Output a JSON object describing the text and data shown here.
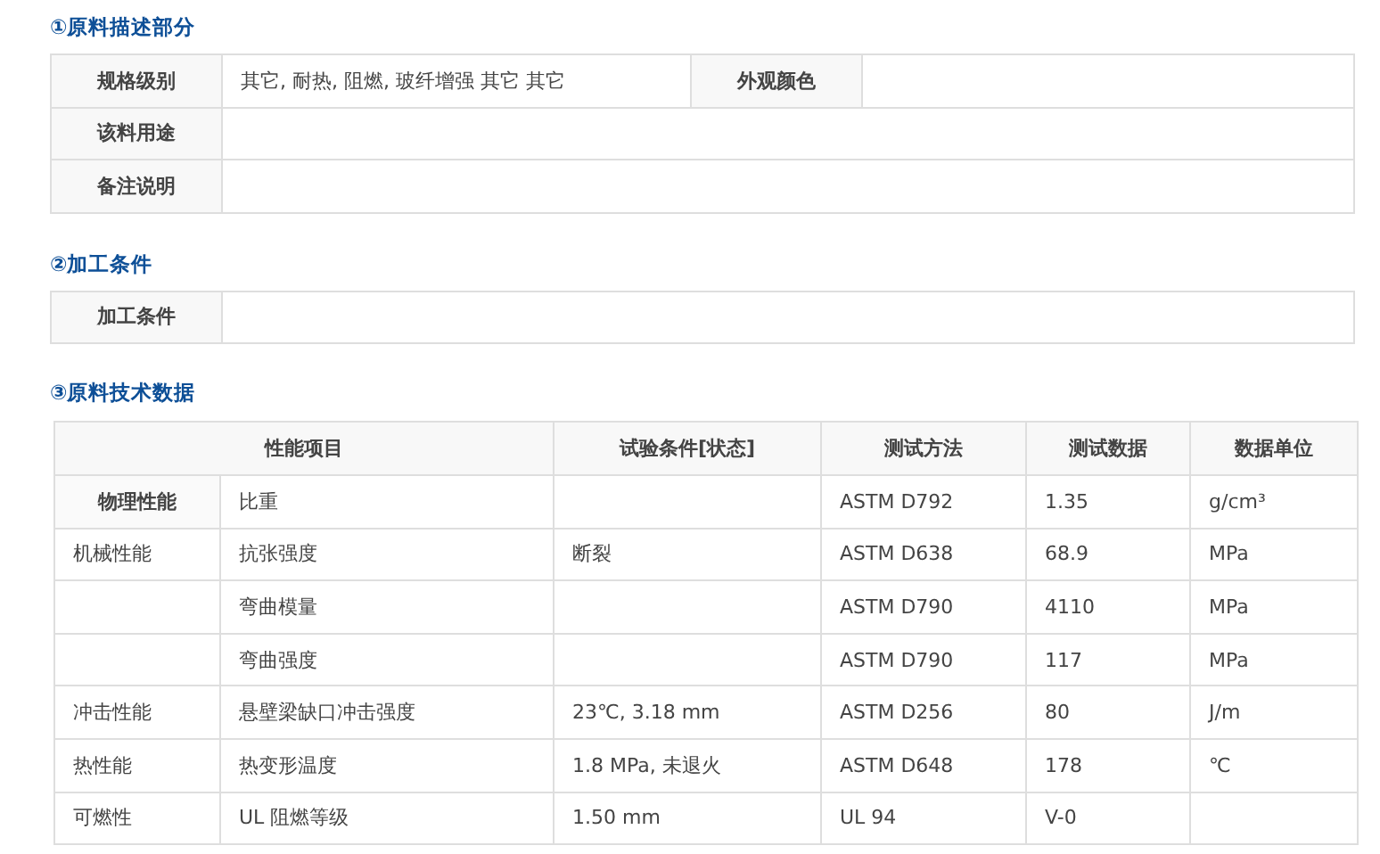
{
  "description": {
    "title": "①原料描述部分",
    "rows": [
      {
        "cells": [
          {
            "kind": "label",
            "text": "规格级别"
          },
          {
            "kind": "value",
            "text": "其它, 耐热, 阻燃, 玻纤增强 其它 其它"
          },
          {
            "kind": "label",
            "text": "外观颜色"
          },
          {
            "kind": "value"
          }
        ]
      },
      {
        "cells": [
          {
            "kind": "label",
            "text": "该料用途"
          },
          {
            "kind": "value"
          }
        ]
      },
      {
        "cells": [
          {
            "kind": "label",
            "text": "备注说明"
          },
          {
            "kind": "value"
          }
        ]
      }
    ]
  },
  "processing": {
    "title": "②加工条件",
    "rows": [
      {
        "cells": [
          {
            "kind": "label",
            "text": "加工条件"
          },
          {
            "kind": "value"
          }
        ]
      }
    ]
  },
  "properties": {
    "title": "③原料技术数据",
    "columns": [
      "性能项目",
      "试验条件[状态]",
      "测试方法",
      "测试数据",
      "数据单位"
    ],
    "rows": [
      {
        "group": "物理性能",
        "group_bold": true,
        "item": "比重",
        "method": "ASTM D792",
        "data": "1.35",
        "unit": "g/cm³"
      },
      {
        "group": "机械性能",
        "group_bold": false,
        "item": "抗张强度",
        "condition": "断裂",
        "method": "ASTM D638",
        "data": "68.9",
        "unit": "MPa"
      },
      {
        "item": "弯曲模量",
        "method": "ASTM D790",
        "data": "4110",
        "unit": "MPa"
      },
      {
        "item": "弯曲强度",
        "method": "ASTM D790",
        "data": "117",
        "unit": "MPa"
      },
      {
        "group": "冲击性能",
        "group_bold": false,
        "item": "悬壁梁缺口冲击强度",
        "condition": "23℃, 3.18 mm",
        "method": "ASTM D256",
        "data": "80",
        "unit": "J/m"
      },
      {
        "group": "热性能",
        "group_bold": false,
        "item": "热变形温度",
        "condition": "1.8 MPa, 未退火",
        "method": "ASTM D648",
        "data": "178",
        "unit": "℃"
      },
      {
        "group": "可燃性",
        "group_bold": false,
        "item": "UL 阻燃等级",
        "condition": "1.50 mm",
        "method": "UL 94",
        "data": "V-0"
      }
    ]
  }
}
